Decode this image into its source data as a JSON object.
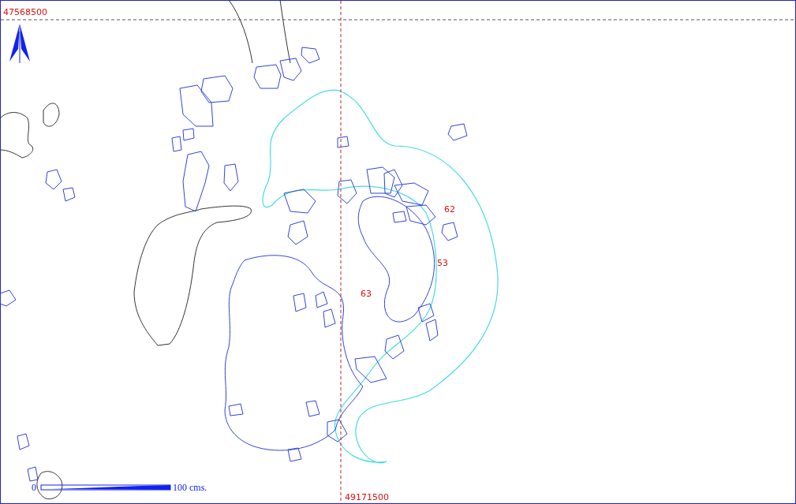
{
  "grid": {
    "northing_label": "47568500",
    "easting_label": "49171500"
  },
  "units": [
    {
      "label": "62"
    },
    {
      "label": "53"
    },
    {
      "label": "63"
    }
  ],
  "scale_bar": {
    "start_label": "0",
    "end_label": "100 cms."
  }
}
